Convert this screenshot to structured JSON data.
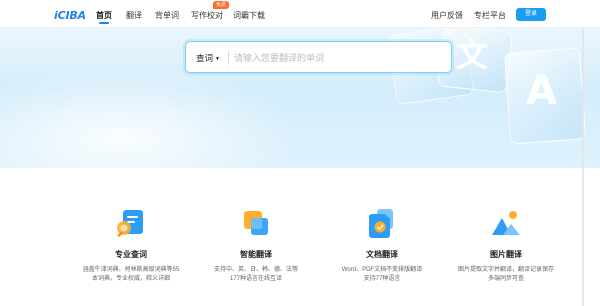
{
  "nav": {
    "logo": "iCIBA",
    "items": [
      {
        "label": "首页",
        "active": true
      },
      {
        "label": "翻译"
      },
      {
        "label": "背单词"
      },
      {
        "label": "写作校对",
        "badge": "免费"
      },
      {
        "label": "词霸下载"
      }
    ],
    "right_items": [
      {
        "label": "用户反馈"
      },
      {
        "label": "专栏平台"
      }
    ],
    "login_label": "登录"
  },
  "hero": {
    "decor_glyphs": [
      "文",
      "A"
    ]
  },
  "search": {
    "type_label": "查词",
    "placeholder": "请输入您要翻译的单词"
  },
  "features": [
    {
      "icon": "dictionary-lookup-icon",
      "title": "专业查词",
      "desc_lines": [
        "涵盖牛津词典、柯林斯高级词典等55",
        "本词典。专业权威，释义详细"
      ]
    },
    {
      "icon": "smart-translate-icon",
      "title": "智能翻译",
      "desc_lines": [
        "支持中、英、日、韩、德、法等",
        "177种语言在线互译"
      ]
    },
    {
      "icon": "document-translate-icon",
      "title": "文档翻译",
      "desc_lines": [
        "Word、PDF文档不变排版翻译",
        "支持77种语言"
      ]
    },
    {
      "icon": "image-translate-icon",
      "title": "图片翻译",
      "desc_lines": [
        "图片提取文字并翻译，翻译记录保存",
        "多端同步可查"
      ]
    }
  ],
  "colors": {
    "brand": "#1f84e6",
    "login_button": "#1a9cf2",
    "badge": "#ff6a2c",
    "hero_bg": "#d4edfb",
    "icon_blue": "#2d9cf5",
    "icon_orange": "#ffae2c"
  }
}
